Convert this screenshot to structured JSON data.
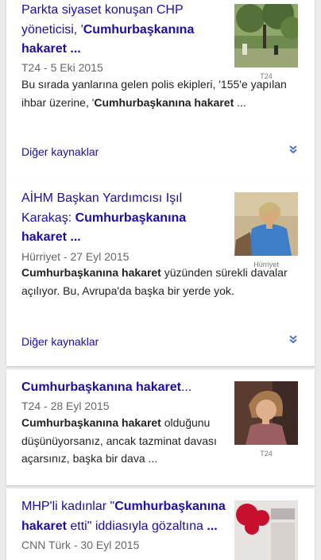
{
  "results": [
    {
      "title_plain": "Parkta siyaset konuşan CHP yöneticisi, '",
      "title_bold": "Cumhurbaşkanına hakaret ...",
      "source": "T24",
      "date": "5 Eki 2015",
      "snippet_plain_1": "Bu sırada yanlarına gelen polis ekipleri, '155'e yapılan ihbar üzerine, '",
      "snippet_bold": "Cumhurbaşkanına hakaret",
      "snippet_plain_2": " ...",
      "image_caption": "T24",
      "more_label": "Diğer kaynaklar"
    },
    {
      "title_plain": "AİHM Başkan Yardımcısı Işıl Karakaş: ",
      "title_bold": "Cumhurbaşkanına hakaret ...",
      "source": "Hürriyet",
      "date": "27 Eyl 2015",
      "snippet_bold": "Cumhurbaşkanına hakaret",
      "snippet_plain_2": " yüzünden sürekli davalar açılıyor. Bu, Avrupa'da başka bir yerde yok.",
      "image_caption": "Hürriyet",
      "more_label": "Diğer kaynaklar"
    },
    {
      "title_bold": "Cumhurbaşkanına hakaret",
      "title_plain_2": "...",
      "source": "T24",
      "date": "28 Eyl 2015",
      "snippet_bold": "Cumhurbaşkanına hakaret",
      "snippet_plain_2": " olduğunu düşünüyorsanız, ancak tazminat davası açarsınız, başka bir dava ...",
      "image_caption": "T24"
    },
    {
      "title_plain": "MHP'li kadınlar \"",
      "title_bold": "Cumhurbaşkanına hakaret",
      "title_plain_2": " etti\" iddiasıyla gözaltına ",
      "title_bold_2": "...",
      "source": "CNN Türk",
      "date": "30 Eyl 2015"
    }
  ],
  "separator": " - "
}
